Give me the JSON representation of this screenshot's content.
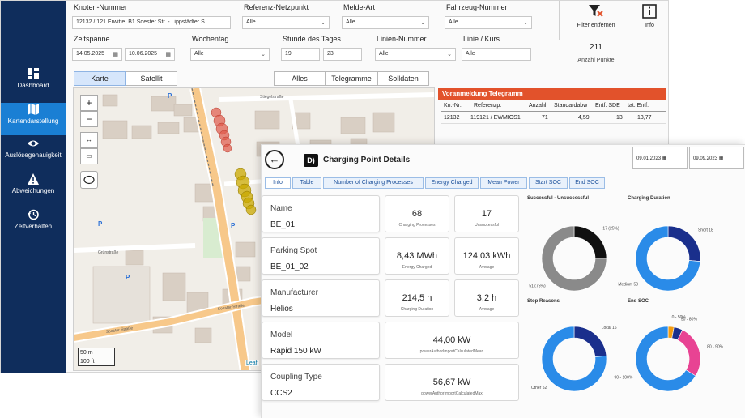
{
  "sidebar": {
    "items": [
      {
        "label": "Dashboard",
        "icon": "dashboard-icon"
      },
      {
        "label": "Kartendarstellung",
        "icon": "map-icon"
      },
      {
        "label": "Auslösegenauigkeit",
        "icon": "eye-icon"
      },
      {
        "label": "Abweichungen",
        "icon": "warning-icon"
      },
      {
        "label": "Zeitverhalten",
        "icon": "history-icon"
      }
    ]
  },
  "filters": {
    "knoten_label": "Knoten-Nummer",
    "knoten_value": "12132 / 121 Erwitte, B1 Soester Str. - Lippstädter S...",
    "referenz_label": "Referenz-Netzpunkt",
    "referenz_value": "Alle",
    "melde_label": "Melde-Art",
    "melde_value": "Alle",
    "fahrzeug_label": "Fahrzeug-Nummer",
    "fahrzeug_value": "Alle",
    "zeitspanne_label": "Zeitspanne",
    "date_from": "14.05.2025",
    "date_to": "10.06.2025",
    "wochentag_label": "Wochentag",
    "wochentag_value": "Alle",
    "stunde_label": "Stunde des Tages",
    "stunde_from": "19",
    "stunde_to": "23",
    "linien_label": "Linien-Nummer",
    "linien_value": "Alle",
    "kurs_label": "Linie / Kurs",
    "kurs_value": "Alle",
    "filter_remove_label": "Filter entfernen",
    "info_label": "Info",
    "points_count": "211",
    "points_label": "Anzahl Punkte"
  },
  "view_toggle": {
    "karte": "Karte",
    "satellit": "Satellit"
  },
  "telegram_toggle": {
    "alles": "Alles",
    "telegramme": "Telegramme",
    "solldaten": "Solldaten"
  },
  "map": {
    "scale_m": "50 m",
    "scale_ft": "100 ft",
    "attribution": "Leaf",
    "street_labels": [
      "Soester Straße",
      "Soester Straße",
      "Grünstraße",
      "Stiegelstraße"
    ]
  },
  "telegram_table": {
    "title": "Voranmeldung Telegramm",
    "columns": [
      "Kn.-Nr.",
      "Referenzp.",
      "Anzahl",
      "Standardabw",
      "Entf. SDE",
      "tat. Entf."
    ],
    "rows": [
      [
        "12132",
        "119121 / EWMIOS1",
        "71",
        "4,59",
        "13",
        "13,77"
      ]
    ]
  },
  "details": {
    "title": "Charging Point Details",
    "brand": "D)",
    "date_from": "09.01.2023",
    "date_to": "09.09.2023",
    "tabs": [
      "Info",
      "Table",
      "Number of Charging Processes",
      "Energy Charged",
      "Mean Power",
      "Start SOC",
      "End SOC"
    ],
    "info": [
      {
        "label": "Name",
        "value": "BE_01"
      },
      {
        "label": "Parking Spot",
        "value": "BE_01_02"
      },
      {
        "label": "Manufacturer",
        "value": "Helios"
      },
      {
        "label": "Model",
        "value": "Rapid 150 kW"
      },
      {
        "label": "Coupling Type",
        "value": "CCS2"
      }
    ],
    "kpis": [
      {
        "value": "68",
        "label": "Charging Processes"
      },
      {
        "value": "17",
        "label": "Unsuccessful"
      },
      {
        "value": "8,43 MWh",
        "label": "Energy Charged"
      },
      {
        "value": "124,03 kWh",
        "label": "Average"
      },
      {
        "value": "214,5 h",
        "label": "Charging Duration"
      },
      {
        "value": "3,2 h",
        "label": "Average"
      },
      {
        "value": "44,00 kW",
        "label": "powerAuthorImportCalculatedMean"
      },
      {
        "value": "56,67 kW",
        "label": "powerAuthorImportCalculatedMax"
      }
    ],
    "chart_titles": {
      "success": "Successful - Unsuccessful",
      "duration": "Charging Duration",
      "stop": "Stop Reasons",
      "endsoc": "End SOC"
    }
  },
  "chart_data": [
    {
      "type": "pie",
      "title": "Successful - Unsuccessful",
      "labels": [
        "unsuccessful",
        "successful"
      ],
      "values": [
        17,
        51
      ],
      "value_labels": [
        "17 (25%)",
        "51 (75%)"
      ],
      "colors": [
        "#111111",
        "#8a8a8a"
      ]
    },
    {
      "type": "pie",
      "title": "Charging Duration",
      "labels": [
        "Short",
        "Medium"
      ],
      "values": [
        18,
        50
      ],
      "value_labels": [
        "Short 18",
        "Medium 50"
      ],
      "colors": [
        "#1a2f8c",
        "#2a8be8"
      ]
    },
    {
      "type": "pie",
      "title": "Stop Reasons",
      "labels": [
        "Local",
        "Other"
      ],
      "values": [
        16,
        52
      ],
      "value_labels": [
        "Local 16",
        "Other 52"
      ],
      "colors": [
        "#1a2f8c",
        "#2a8be8"
      ]
    },
    {
      "type": "pie",
      "title": "End SOC",
      "labels": [
        "0 - 50%",
        "50 - 80%",
        "80 - 90%",
        "90 - 100%"
      ],
      "values": [
        2,
        3,
        18,
        45
      ],
      "value_labels": [
        "0 - 50%",
        "50 - 80%",
        "80 - 90%",
        "90 - 100%"
      ],
      "colors": [
        "#f39c12",
        "#1a2f8c",
        "#e84393",
        "#2a8be8"
      ]
    }
  ]
}
